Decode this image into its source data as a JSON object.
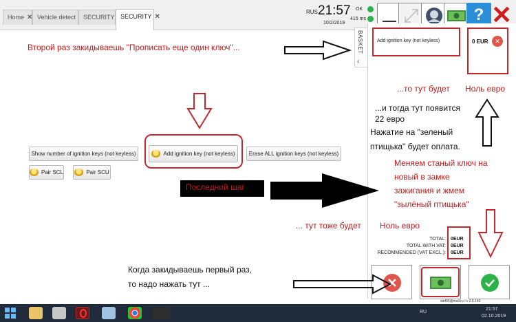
{
  "tabs": [
    {
      "label": "Home"
    },
    {
      "label": "Vehicle detect"
    },
    {
      "label": "SECURITY"
    },
    {
      "label": "SECURITY"
    }
  ],
  "header": {
    "lang": "RUS",
    "time": "21:57",
    "date": "10/2/2019",
    "status_ok": "OK",
    "status_ping": "415 ms",
    "close_glyph": "✕"
  },
  "basket": {
    "tab_label": "BASKET",
    "item_label": "Add ignition key (not keyless)",
    "item_price": "0 EUR",
    "total_label": "TOTAL:",
    "total_value": "0EUR",
    "total_vat_label": "TOTAL WITH VAT:",
    "total_vat_value": "0EUR",
    "recommended_label": "RECOMMENDED (VAT EXCL.):",
    "recommended_value": "0EUR",
    "user_info": "stef05@mail.ru / v 2.5.140"
  },
  "main": {
    "show_keys": "Show number of ignition keys (not keyless)",
    "add_key": "Add ignition key (not keyless)",
    "erase_keys": "Erase ALL ignition keys (not keyless)",
    "pair_scl": "Pair SCL",
    "pair_scu": "Pair SCU"
  },
  "notes": {
    "n1": "Второй раз закидываешь  \"Прописать еще один ключ\"...",
    "n2": "...то тут будет",
    "n3": "Ноль евро",
    "n4": "...и тогда тут появится",
    "n5": "22 евро",
    "n6": "Нажатие на \"зеленый",
    "n7": "птищька\" будет оплата.",
    "n8": "Меняем станый ключ на",
    "n9": "новый в замке",
    "n10": "зажигания и жмем",
    "n11": "\"зылёный птищька\"",
    "n12": "Последний шаг",
    "n13": "... тут тоже будет",
    "n14": "Ноль евро",
    "n15": "Когда закидываешь первый раз,",
    "n16": "то надо нажать тут ..."
  },
  "taskbar": {
    "lang": "RU",
    "time": "21:57",
    "date": "02.10.2019"
  },
  "colors": {
    "annotation_red": "#c0282e",
    "ok_green": "#2bb24c",
    "confirm_green": "#2db24a",
    "cancel_red": "#e0554a",
    "help_blue": "#2a8fd6"
  },
  "icons": [
    "minimize-icon",
    "resize-icon",
    "user-icon",
    "money-icon",
    "help-icon",
    "close-icon",
    "cancel-icon",
    "check-icon",
    "coin-icon"
  ]
}
